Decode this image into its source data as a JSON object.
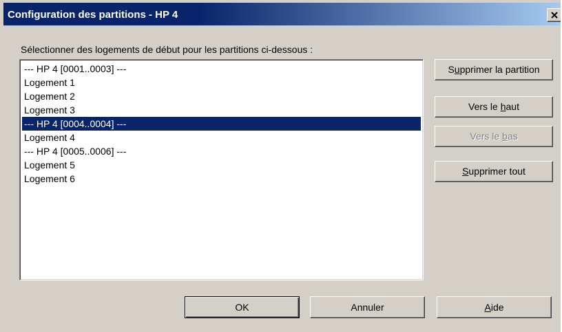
{
  "window": {
    "title": "Configuration des partitions - HP 4",
    "close_label": "×"
  },
  "instruction": "Sélectionner des logements de début pour les partitions ci-dessous :",
  "list": {
    "items": [
      {
        "label": "--- HP 4 [0001..0003] ---",
        "selected": false
      },
      {
        "label": "Logement 1",
        "selected": false
      },
      {
        "label": "Logement 2",
        "selected": false
      },
      {
        "label": "Logement 3",
        "selected": false
      },
      {
        "label": "--- HP 4 [0004..0004] ---",
        "selected": true
      },
      {
        "label": "Logement 4",
        "selected": false
      },
      {
        "label": "--- HP 4 [0005..0006] ---",
        "selected": false
      },
      {
        "label": "Logement 5",
        "selected": false
      },
      {
        "label": "Logement 6",
        "selected": false
      }
    ]
  },
  "side_buttons": {
    "delete_partition": {
      "pre": "S",
      "u": "u",
      "post": "pprimer la partition"
    },
    "move_up": {
      "pre": "Vers le ",
      "u": "h",
      "post": "aut"
    },
    "move_down": {
      "pre": "Vers le ",
      "u": "b",
      "post": "as",
      "disabled": true
    },
    "delete_all": {
      "pre": "",
      "u": "S",
      "post": "upprimer tout"
    }
  },
  "bottom_buttons": {
    "ok": "OK",
    "cancel": "Annuler",
    "help": {
      "pre": "",
      "u": "A",
      "post": "ide"
    }
  },
  "colors": {
    "titlebar_start": "#0a246a",
    "titlebar_end": "#a6caf0",
    "selection": "#0a246a",
    "dialog_face": "#d4d0c8"
  }
}
